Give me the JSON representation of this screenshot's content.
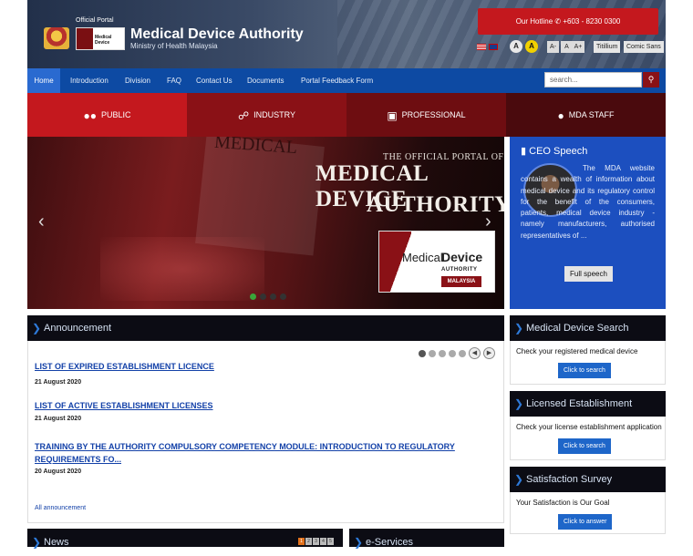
{
  "header": {
    "official_portal": "Official Portal",
    "logo_text": "Medical Device",
    "title": "Medical Device Authority",
    "subtitle": "Ministry of Health Malaysia",
    "hotline_label": "Our Hotline",
    "hotline_number": "+603 - 8230 0300",
    "contrast_a1": "A",
    "contrast_a2": "A",
    "size_minus": "A-",
    "size_normal": "A",
    "size_plus": "A+",
    "font_1": "Titillium",
    "font_2": "Comic Sans"
  },
  "nav": {
    "items": [
      "Home",
      "Introduction",
      "Division",
      "FAQ",
      "Contact Us",
      "Documents",
      "Portal Feedback Form"
    ],
    "search_placeholder": "search..."
  },
  "categories": [
    {
      "label": "PUBLIC",
      "icon": "users-icon",
      "color": "#c4181e"
    },
    {
      "label": "INDUSTRY",
      "icon": "handshake-icon",
      "color": "#8a1116"
    },
    {
      "label": "PROFESSIONAL",
      "icon": "briefcase-icon",
      "color": "#6e0d11"
    },
    {
      "label": "MDA STAFF",
      "icon": "user-icon",
      "color": "#4a0a0d"
    }
  ],
  "slider": {
    "background_word": "MEDICAL",
    "subtitle": "THE OFFICIAL PORTAL OF",
    "title_line1": "MEDICAL DEVICE",
    "title_line2": "AUTHORITY",
    "logo_medical": "Medical",
    "logo_device": "Device",
    "logo_authority": "AUTHORITY",
    "logo_malaysia": "MALAYSIA"
  },
  "ceo": {
    "title": "CEO Speech",
    "text": "The MDA website contains a wealth of information about medical device and its regulatory control for the benefit of the consumers, patients, medical device industry - namely manufacturers, authorised representatives of ...",
    "button": "Full speech"
  },
  "announcement": {
    "title": "Announcement",
    "items": [
      {
        "title": "LIST OF EXPIRED ESTABLISHMENT LICENCE",
        "date": "21 August 2020"
      },
      {
        "title": "LIST OF ACTIVE ESTABLISHMENT LICENSES",
        "date": "21 August 2020"
      },
      {
        "title": "TRAINING BY THE AUTHORITY COMPULSORY COMPETENCY MODULE: INTRODUCTION TO REGULATORY REQUIREMENTS FO...",
        "date": "20 August 2020"
      }
    ],
    "all_link": "All announcement",
    "prev": "◀",
    "next": "▶"
  },
  "side_panels": [
    {
      "title": "Medical Device Search",
      "text": "Check your registered medical device",
      "button": "Click to search"
    },
    {
      "title": "Licensed Establishment Search",
      "text": "Check your license establishment application",
      "button": "Click to search"
    },
    {
      "title": "Satisfaction Survey",
      "text": "Your Satisfaction is Our Goal",
      "button": "Click to answer"
    }
  ],
  "bottom": {
    "news_title": "News",
    "news_pages": [
      "1",
      "2",
      "3",
      "4",
      "5"
    ],
    "eservices_title": "e-Services"
  }
}
